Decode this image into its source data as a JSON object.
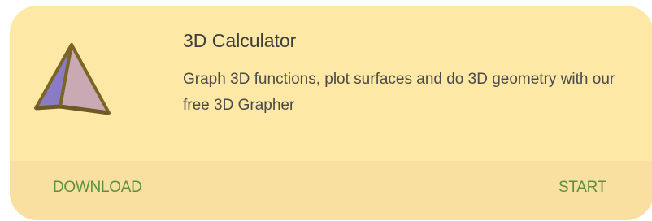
{
  "card": {
    "icon": "pyramid-icon",
    "title": "3D Calculator",
    "description": "Graph 3D functions, plot surfaces and do 3D geometry with our free 3D Grapher",
    "actions": {
      "download_label": "DOWNLOAD",
      "start_label": "START"
    }
  },
  "colors": {
    "card_background": "#fde8a6",
    "actions_background": "#f9dfa0",
    "action_text": "#5d8f3e",
    "title_text": "#3d3d3d"
  }
}
